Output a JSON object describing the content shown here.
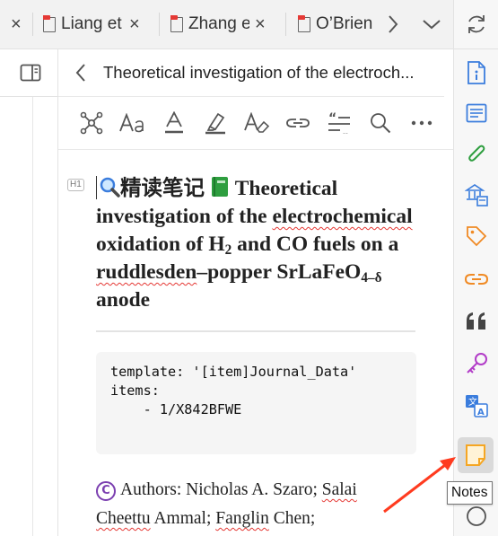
{
  "tabs": [
    {
      "label": "Liang et",
      "close": "×"
    },
    {
      "label": "Zhang e",
      "close": "×"
    },
    {
      "label": "O’Brien",
      "close": ""
    }
  ],
  "first_tab_close": "×",
  "doc": {
    "title": "Theoretical investigation of the electroch...",
    "h1_tag": "H1",
    "heading_prefix": "精读笔记",
    "heading_parts": {
      "p1": "Theoretical investigation of the ",
      "p2": "electrochemical",
      "p3": " oxidation of H",
      "sub1": "2",
      "p4": " and CO fuels on a ",
      "p5": "ruddlesden",
      "p6": "–popper SrLaFeO",
      "sub2": "4–δ",
      "p7": " anode"
    },
    "code": "template: '[item]Journal_Data'\nitems:\n    - 1/X842BFWE",
    "authors_label": "Authors: Nicholas A. Szaro; ",
    "author_a": "Salai",
    "author_a2": "Cheettu",
    "author_b": " Ammal; ",
    "author_c": "Fanglin",
    "author_d": " Chen;"
  },
  "tooltip": "Notes",
  "colors": {
    "accent_blue": "#3b7ddd",
    "green": "#2e9e3f",
    "orange": "#f08a24",
    "purple": "#b23cc8",
    "red": "#e53935",
    "notes_yellow": "#f5a623"
  }
}
